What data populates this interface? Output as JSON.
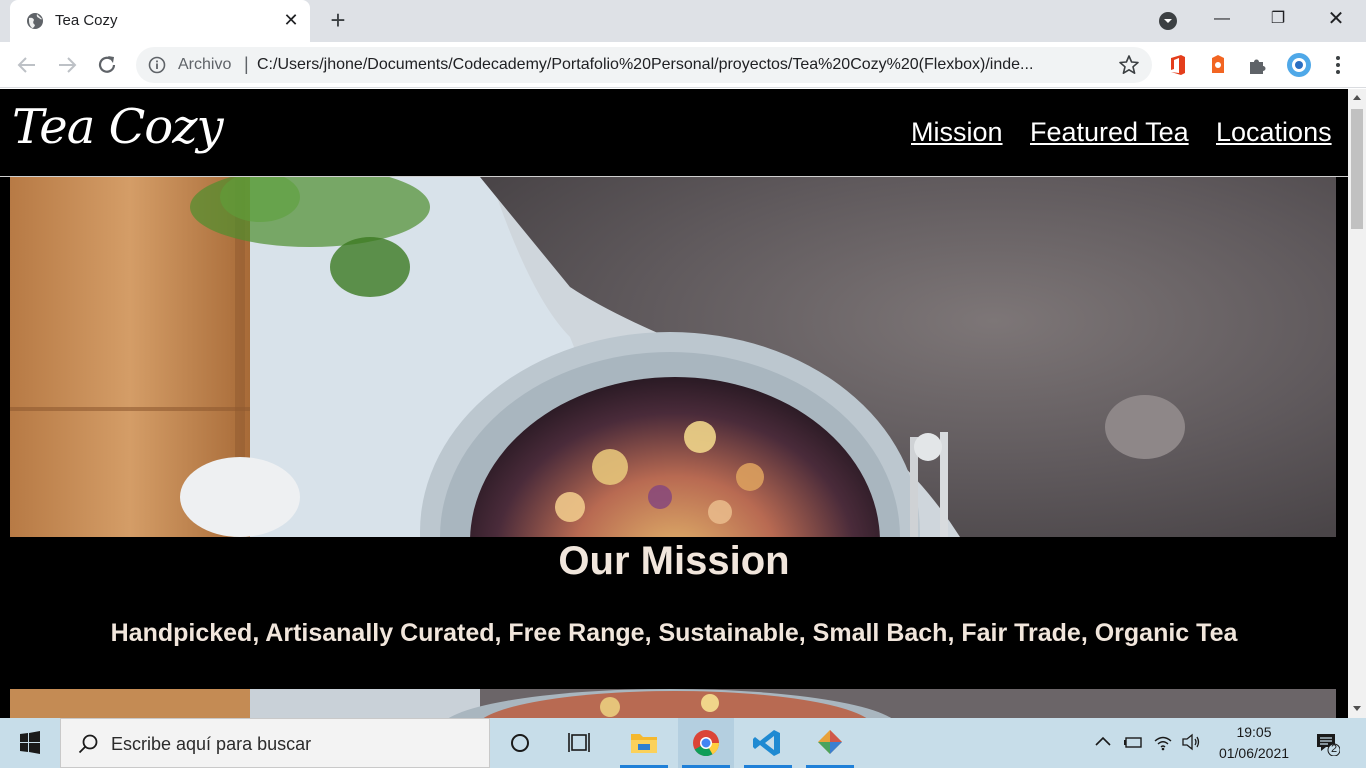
{
  "browser": {
    "tab_title": "Tea Cozy",
    "omnibox_label": "Archivo",
    "url": "C:/Users/jhone/Documents/Codecademy/Portafolio%20Personal/proyectos/Tea%20Cozy%20(Flexbox)/inde..."
  },
  "site": {
    "logo": "Tea Cozy",
    "nav": [
      "Mission",
      "Featured Tea",
      "Locations"
    ],
    "mission_title": "Our Mission",
    "mission_text": "Handpicked, Artisanally Curated, Free Range, Sustainable, Small Bach, Fair Trade, Organic Tea"
  },
  "taskbar": {
    "search_placeholder": "Escribe aquí para buscar",
    "time": "19:05",
    "date": "01/06/2021",
    "notification_count": "2"
  },
  "colors": {
    "page_background": "#000000",
    "mission_text": "#f1e6dc",
    "taskbar": "#c7dde9"
  }
}
